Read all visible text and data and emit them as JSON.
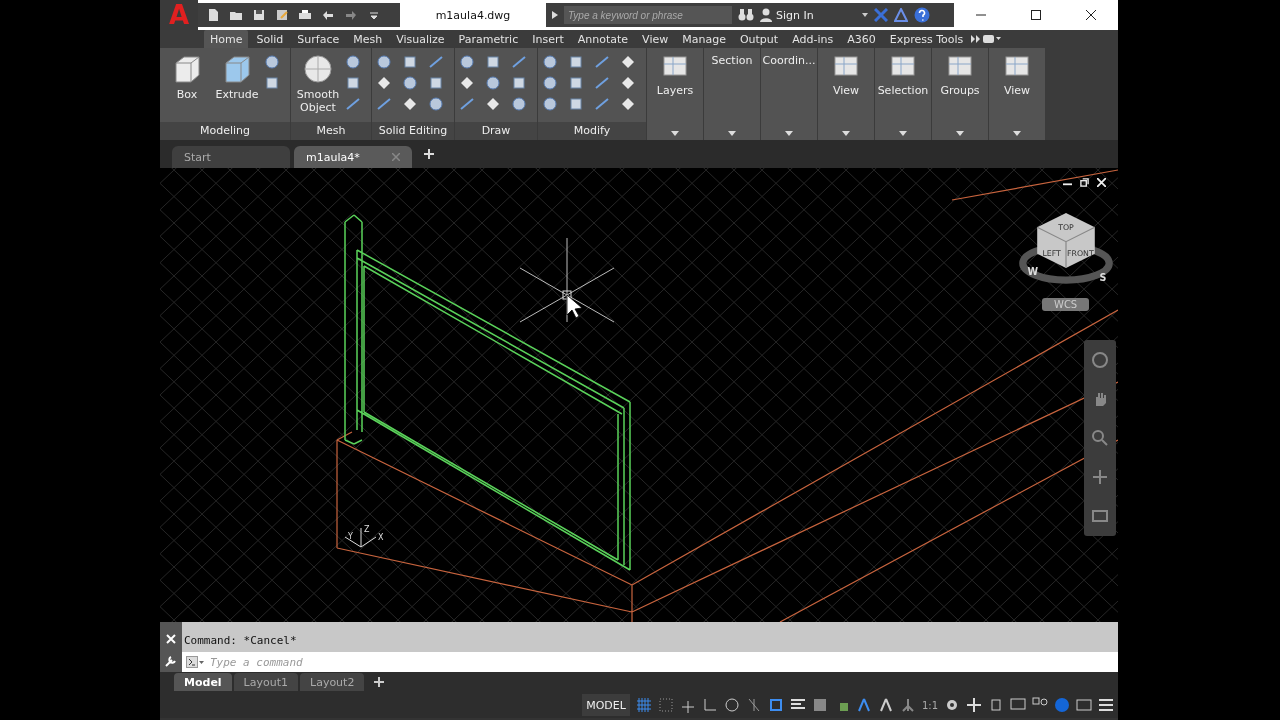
{
  "app": {
    "logo": "A",
    "title": "m1aula4.dwg"
  },
  "search": {
    "placeholder": "Type a keyword or phrase"
  },
  "account": {
    "label": "Sign In"
  },
  "ribbon_tabs": [
    {
      "label": "Home",
      "selected": true
    },
    {
      "label": "Solid",
      "selected": false
    },
    {
      "label": "Surface",
      "selected": false
    },
    {
      "label": "Mesh",
      "selected": false
    },
    {
      "label": "Visualize",
      "selected": false
    },
    {
      "label": "Parametric",
      "selected": false
    },
    {
      "label": "Insert",
      "selected": false
    },
    {
      "label": "Annotate",
      "selected": false
    },
    {
      "label": "View",
      "selected": false
    },
    {
      "label": "Manage",
      "selected": false
    },
    {
      "label": "Output",
      "selected": false
    },
    {
      "label": "Add-ins",
      "selected": false
    },
    {
      "label": "A360",
      "selected": false
    },
    {
      "label": "Express Tools",
      "selected": false
    }
  ],
  "ribbon_panels": [
    {
      "kind": "tools",
      "title": "Modeling",
      "large_buttons": [
        "Box",
        "Extrude"
      ]
    },
    {
      "kind": "tools",
      "title": "Mesh",
      "large_buttons": [
        "Smooth Object"
      ]
    },
    {
      "kind": "tools",
      "title": "Solid Editing"
    },
    {
      "kind": "tools",
      "title": "Draw"
    },
    {
      "kind": "tools",
      "title": "Modify"
    },
    {
      "kind": "collapsed",
      "label": "Layers",
      "icon_above": true
    },
    {
      "kind": "collapsed",
      "label": "Section",
      "icon_above": false
    },
    {
      "kind": "collapsed",
      "label": "Coordin...",
      "icon_above": false
    },
    {
      "kind": "collapsed",
      "label": "View",
      "icon_above": true
    },
    {
      "kind": "collapsed",
      "label": "Selection",
      "icon_above": true
    },
    {
      "kind": "collapsed",
      "label": "Groups",
      "icon_above": true
    },
    {
      "kind": "collapsed",
      "label": "View",
      "icon_above": true
    }
  ],
  "document_tabs": [
    {
      "label": "Start",
      "selected": false
    },
    {
      "label": "m1aula4*",
      "selected": true
    }
  ],
  "viewcube": {
    "faces": [
      "TOP",
      "LEFT",
      "FRONT"
    ],
    "compass": [
      "W",
      "S"
    ],
    "coordinate_system": "WCS"
  },
  "ucs_icon": {
    "axes": [
      "Y",
      "Z",
      "X"
    ]
  },
  "command_line": {
    "history": "Command: *Cancel*",
    "placeholder": "Type a command"
  },
  "layout_tabs": [
    {
      "label": "Model",
      "selected": true
    },
    {
      "label": "Layout1",
      "selected": false
    },
    {
      "label": "Layout2",
      "selected": false
    }
  ],
  "status_bar": {
    "space": "MODEL",
    "scale": "1:1"
  }
}
